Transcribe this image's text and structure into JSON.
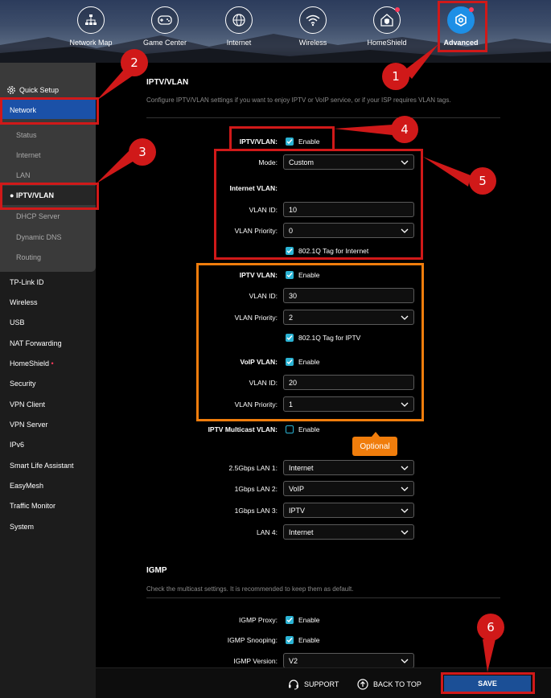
{
  "nav": {
    "items": [
      {
        "label": "Network Map",
        "icon": "network-map-icon"
      },
      {
        "label": "Game Center",
        "icon": "gamepad-icon"
      },
      {
        "label": "Internet",
        "icon": "globe-icon"
      },
      {
        "label": "Wireless",
        "icon": "wifi-icon"
      },
      {
        "label": "HomeShield",
        "icon": "home-shield-icon"
      },
      {
        "label": "Advanced",
        "icon": "gear-hex-icon"
      }
    ],
    "active": "Advanced"
  },
  "sidebar": {
    "quick_setup": "Quick Setup",
    "network": "Network",
    "network_sub": [
      "Status",
      "Internet",
      "LAN",
      "IPTV/VLAN",
      "DHCP Server",
      "Dynamic DNS",
      "Routing"
    ],
    "items": [
      "TP-Link ID",
      "Wireless",
      "USB",
      "NAT Forwarding",
      "HomeShield",
      "Security",
      "VPN Client",
      "VPN Server",
      "IPv6",
      "Smart Life Assistant",
      "EasyMesh",
      "Traffic Monitor",
      "System"
    ]
  },
  "iptv": {
    "title": "IPTV/VLAN",
    "description": "Configure IPTV/VLAN settings if you want to enjoy IPTV or VoIP service, or if your ISP requires VLAN tags.",
    "iptv_vlan_label": "IPTV/VLAN:",
    "enable": "Enable",
    "mode_label": "Mode:",
    "mode_value": "Custom",
    "internet_vlan_label": "Internet VLAN:",
    "vlan_id_label": "VLAN ID:",
    "vlan_priority_label": "VLAN Priority:",
    "internet_vlan_id": "10",
    "internet_vlan_priority": "0",
    "internet_tag": "802.1Q Tag for Internet",
    "iptv_vlan2_label": "IPTV VLAN:",
    "iptv_vlan_id": "30",
    "iptv_vlan_priority": "2",
    "iptv_tag": "802.1Q Tag for IPTV",
    "voip_vlan_label": "VoIP VLAN:",
    "voip_vlan_id": "20",
    "voip_vlan_priority": "1",
    "multicast_label": "IPTV Multicast VLAN:",
    "optional": "Optional",
    "lan_ports": [
      {
        "label": "2.5Gbps LAN 1:",
        "value": "Internet"
      },
      {
        "label": "1Gbps LAN 2:",
        "value": "VoIP"
      },
      {
        "label": "1Gbps LAN 3:",
        "value": "IPTV"
      },
      {
        "label": "LAN 4:",
        "value": "Internet"
      }
    ]
  },
  "igmp": {
    "title": "IGMP",
    "description": "Check the multicast settings. It is recommended to keep them as default.",
    "proxy_label": "IGMP Proxy:",
    "snooping_label": "IGMP Snooping:",
    "version_label": "IGMP Version:",
    "version_value": "V2",
    "enable": "Enable"
  },
  "footer": {
    "support": "SUPPORT",
    "back_to_top": "BACK TO TOP",
    "save": "SAVE"
  },
  "callouts": [
    "1",
    "2",
    "3",
    "4",
    "5",
    "6"
  ],
  "colors": {
    "accent_blue": "#1b51a8",
    "checkbox": "#2bb3d4",
    "annotation_red": "#d01919",
    "annotation_orange": "#f07d0c"
  }
}
